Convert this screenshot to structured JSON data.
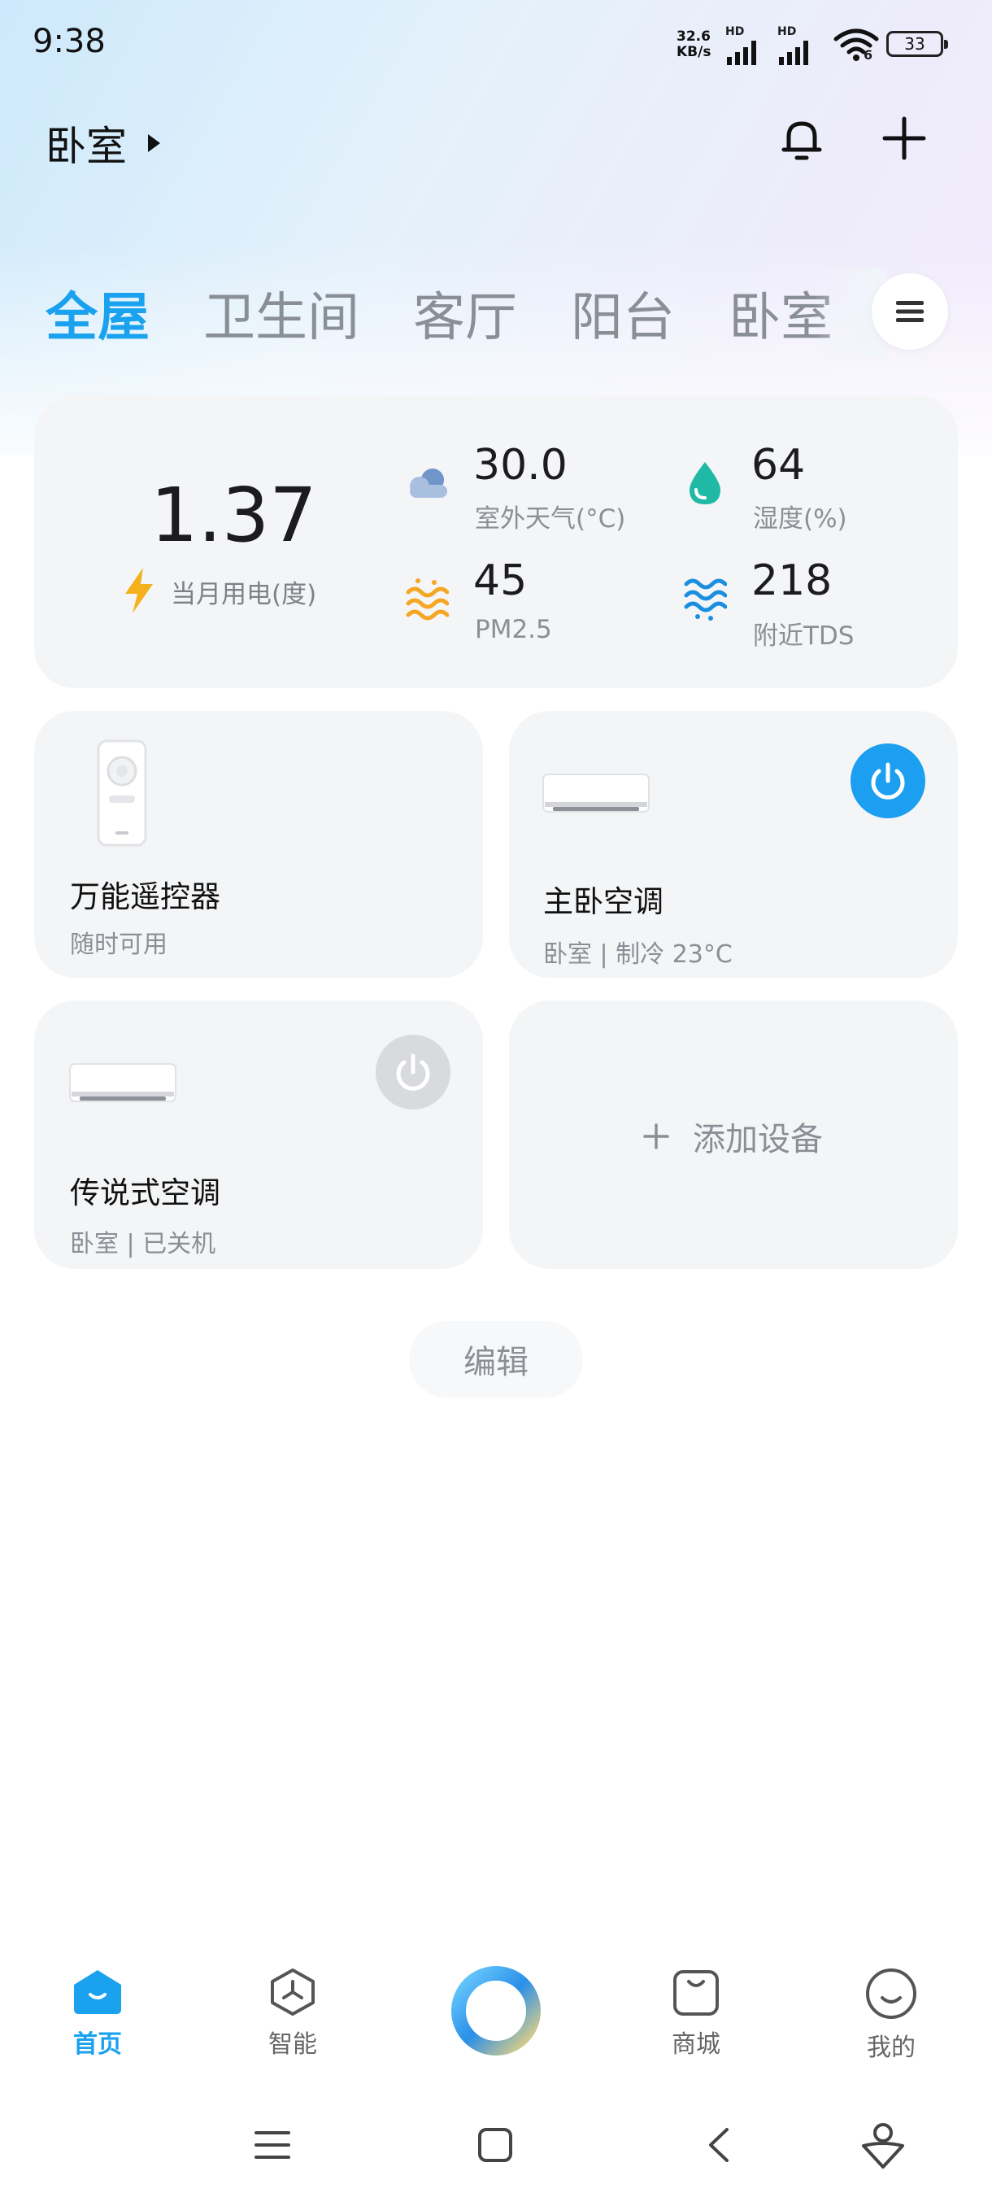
{
  "status_bar": {
    "time": "9:38",
    "net_speed_value": "32.6",
    "net_speed_unit": "KB/s",
    "hd_label": "HD",
    "wifi_sub": "6",
    "battery": "33"
  },
  "header": {
    "room": "卧室"
  },
  "tabs": [
    "全屋",
    "卫生间",
    "客厅",
    "阳台",
    "卧室"
  ],
  "stats": {
    "power_value": "1.37",
    "power_label": "当月用电(度)",
    "temp_value": "30.0",
    "temp_label": "室外天气(°C)",
    "humidity_value": "64",
    "humidity_label": "湿度(%)",
    "pm_value": "45",
    "pm_label": "PM2.5",
    "tds_value": "218",
    "tds_label": "附近TDS"
  },
  "devices": [
    {
      "name": "万能遥控器",
      "status": "随时可用"
    },
    {
      "name": "主卧空调",
      "status": "卧室 | 制冷 23°C"
    },
    {
      "name": "传说式空调",
      "status": "卧室 | 已关机"
    }
  ],
  "add_device_label": "添加设备",
  "edit_label": "编辑",
  "bottom_nav": [
    {
      "label": "首页"
    },
    {
      "label": "智能"
    },
    {
      "label": "商城"
    },
    {
      "label": "我的"
    }
  ],
  "colors": {
    "accent": "#1aa2ee",
    "power_on": "#1c9ff0",
    "bolt": "#f5b11b"
  }
}
